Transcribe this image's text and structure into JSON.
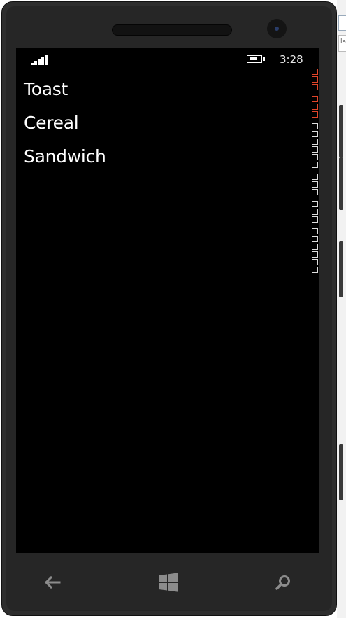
{
  "status_bar": {
    "time": "3:28",
    "signal_icon": "signal-bars-icon",
    "battery_icon": "battery-charging-icon"
  },
  "list": {
    "items": [
      {
        "label": "Toast"
      },
      {
        "label": "Cereal"
      },
      {
        "label": "Sandwich"
      }
    ]
  },
  "host_window": {
    "tab_label": "la"
  },
  "navbar": {
    "back_icon": "back-arrow-icon",
    "start_icon": "windows-start-icon",
    "search_icon": "search-icon"
  },
  "colors": {
    "screen_background": "#000000",
    "phone_body": "#2e2e2e",
    "text": "#ffffff",
    "counter_red": "#e0452a"
  }
}
